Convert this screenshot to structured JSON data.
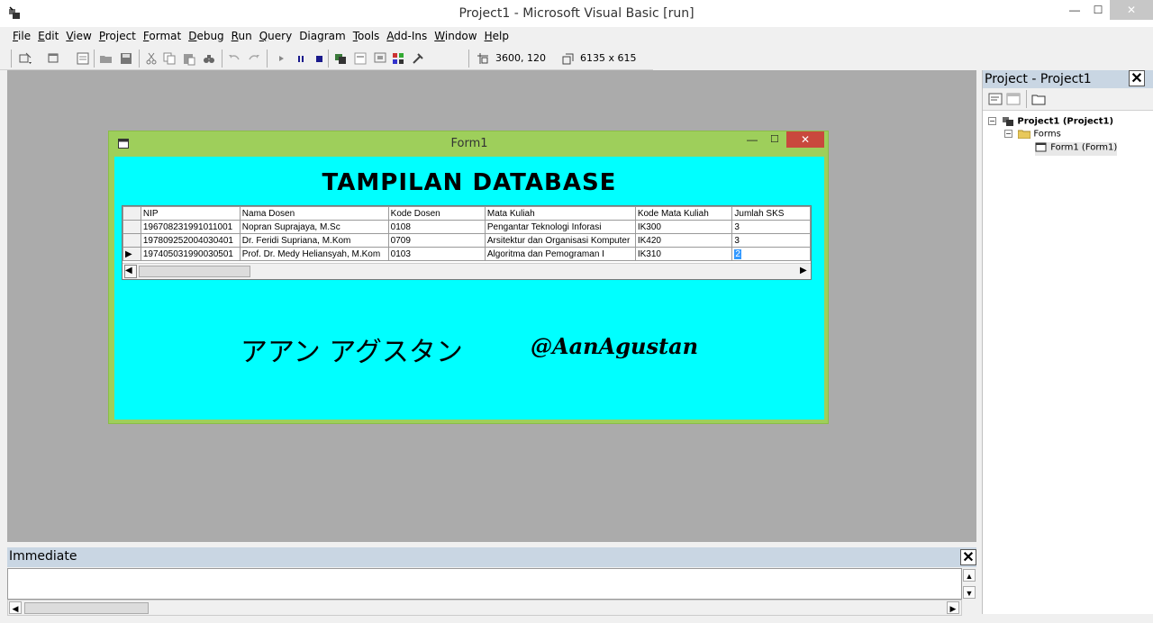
{
  "window": {
    "title": "Project1 - Microsoft Visual Basic [run]",
    "min_glyph": "—",
    "max_glyph": "☐",
    "close_glyph": "✕"
  },
  "menu": [
    {
      "label_ul": "F",
      "label_rest": "ile"
    },
    {
      "label_ul": "E",
      "label_rest": "dit"
    },
    {
      "label_ul": "V",
      "label_rest": "iew"
    },
    {
      "label_ul": "P",
      "label_rest": "roject"
    },
    {
      "label_ul": "F",
      "label_rest": "ormat",
      "plain": "Format"
    },
    {
      "label_ul": "D",
      "label_rest": "ebug"
    },
    {
      "label_ul": "R",
      "label_rest": "un"
    },
    {
      "label_ul": "Q",
      "label_rest": "uery"
    },
    {
      "label_ul": "",
      "label_rest": "Diagram"
    },
    {
      "label_ul": "T",
      "label_rest": "ools"
    },
    {
      "label_ul": "A",
      "label_rest": "dd-Ins"
    },
    {
      "label_ul": "W",
      "label_rest": "indow"
    },
    {
      "label_ul": "H",
      "label_rest": "elp"
    }
  ],
  "toolbar": {
    "position_readout": "3600, 120",
    "size_readout": "6135 x 615",
    "icons": [
      "add-project-icon",
      "add-form-icon",
      "menu-editor-icon",
      "open-icon",
      "save-icon",
      "cut-icon",
      "copy-icon",
      "paste-icon",
      "find-icon",
      "undo-icon",
      "redo-icon",
      "start-icon",
      "break-icon",
      "end-icon",
      "project-explorer-icon",
      "properties-icon",
      "form-layout-icon",
      "object-browser-icon",
      "toolbox-icon"
    ]
  },
  "form1": {
    "title": "Form1",
    "heading": "TAMPILAN DATABASE",
    "jp_name": "アアン アグスタン",
    "handle": "@AanAgustan",
    "grid": {
      "columns": [
        "NIP",
        "Nama Dosen",
        "Kode Dosen",
        "Mata Kuliah",
        "Kode Mata Kuliah",
        "Jumlah SKS"
      ],
      "rows": [
        [
          "196708231991011001",
          "Nopran Suprajaya, M.Sc",
          "0108",
          "Pengantar Teknologi Inforasi",
          "IK300",
          "3"
        ],
        [
          "197809252004030401",
          "Dr. Feridi Supriana, M.Kom",
          "0709",
          "Arsitektur dan Organisasi Komputer",
          "IK420",
          "3"
        ],
        [
          "197405031990030501",
          "Prof. Dr. Medy Heliansyah, M.Kom",
          "0103",
          "Algoritma dan Pemograman I",
          "IK310",
          "2"
        ]
      ],
      "current_row_marker": "▶"
    }
  },
  "project_panel": {
    "title": "Project - Project1",
    "close_glyph": "✕",
    "tree": {
      "project": "Project1 (Project1)",
      "folder": "Forms",
      "item": "Form1 (Form1)",
      "collapse_glyph": "−"
    }
  },
  "immediate": {
    "title": "Immediate",
    "close_glyph": "✕"
  },
  "colors": {
    "form_frame": "#9ecf5b",
    "form_client": "#00ffff",
    "workspace": "#ababab",
    "panel_header": "#c9d6e3",
    "close_red": "#c9483d"
  }
}
